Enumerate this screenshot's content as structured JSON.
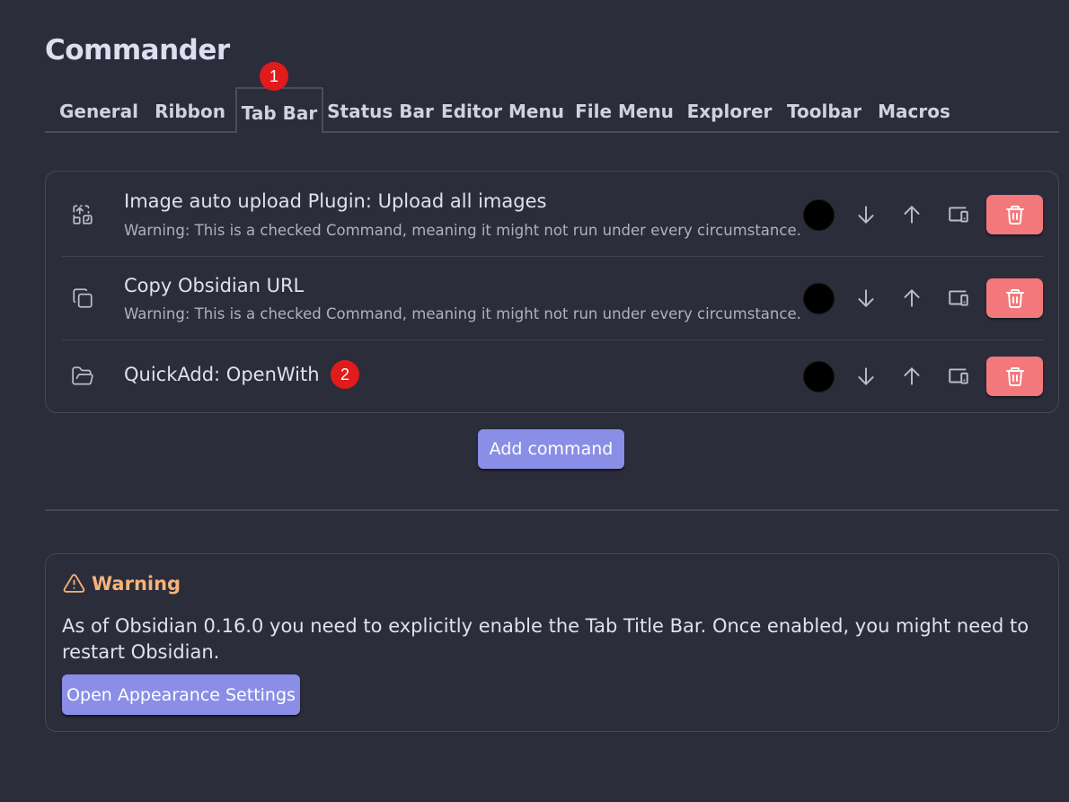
{
  "page_title": "Commander",
  "tabs": [
    {
      "label": "General"
    },
    {
      "label": "Ribbon"
    },
    {
      "label": "Tab Bar",
      "active": true
    },
    {
      "label": "Status Bar"
    },
    {
      "label": "Editor Menu"
    },
    {
      "label": "File Menu"
    },
    {
      "label": "Explorer"
    },
    {
      "label": "Toolbar"
    },
    {
      "label": "Macros"
    }
  ],
  "badges": [
    "1",
    "2"
  ],
  "commands": [
    {
      "icon": "image-upload-icon",
      "name": "Image auto upload Plugin: Upload all images",
      "warning": "Warning: This is a checked Command, meaning it might not run under every circumstance.",
      "color": "#000000"
    },
    {
      "icon": "copy-icon",
      "name": "Copy Obsidian URL",
      "warning": "Warning: This is a checked Command, meaning it might not run under every circumstance.",
      "color": "#000000"
    },
    {
      "icon": "folder-open-icon",
      "name": "QuickAdd: OpenWith",
      "warning": "",
      "color": "#000000"
    }
  ],
  "add_command_label": "Add command",
  "warning_callout": {
    "title": "Warning",
    "text": "As of Obsidian 0.16.0 you need to explicitly enable the Tab Title Bar. Once enabled, you might need to restart Obsidian.",
    "button_label": "Open Appearance Settings"
  },
  "colors": {
    "background": "#2b2d3a",
    "accent": "#8a8ee6",
    "delete": "#f3787c",
    "warning": "#f6b27a",
    "badge": "#e01b1b"
  }
}
